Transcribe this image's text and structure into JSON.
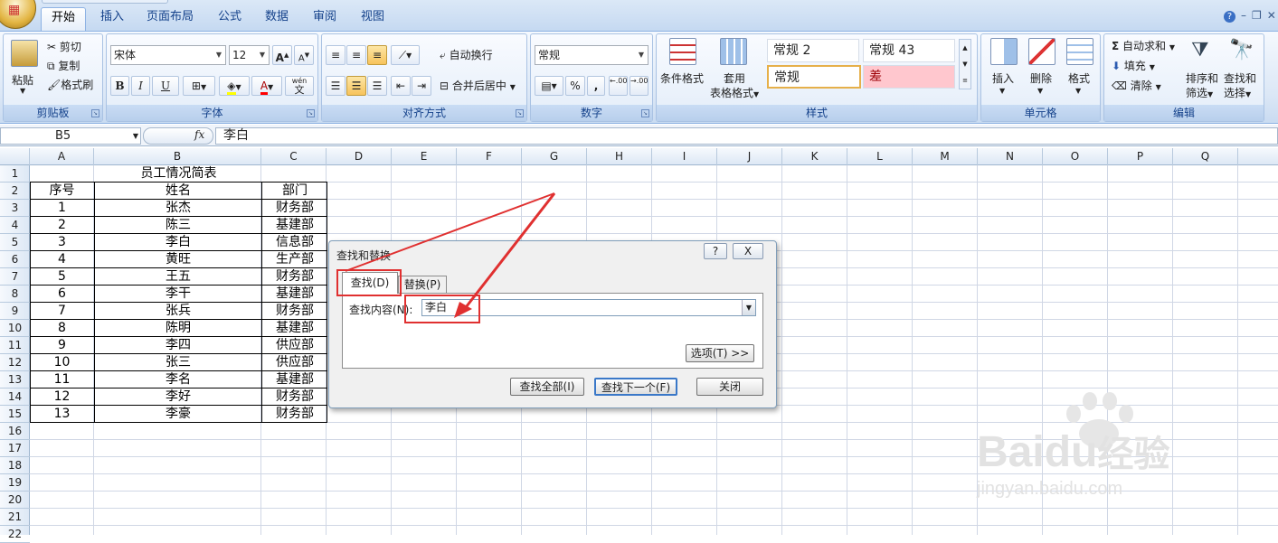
{
  "tabs": [
    {
      "label": "开始",
      "active": true
    },
    {
      "label": "插入"
    },
    {
      "label": "页面布局"
    },
    {
      "label": "公式"
    },
    {
      "label": "数据"
    },
    {
      "label": "审阅"
    },
    {
      "label": "视图"
    }
  ],
  "ribbon": {
    "clipboard": {
      "paste": "粘贴",
      "cut": "剪切",
      "copy": "复制",
      "format_painter": "格式刷",
      "group_label": "剪贴板"
    },
    "font": {
      "name": "宋体",
      "size": "12",
      "bold": "B",
      "italic": "I",
      "underline": "U",
      "grow": "A",
      "shrink": "A",
      "font_color": "A",
      "wen": "wén",
      "wen_char": "文",
      "group_label": "字体"
    },
    "alignment": {
      "wrap": "自动换行",
      "merge": "合并后居中",
      "group_label": "对齐方式"
    },
    "number": {
      "format": "常规",
      "percent": "%",
      "comma": ",",
      "inc_decimal": ".00",
      "dec_decimal": ".00",
      "group_label": "数字"
    },
    "styles": {
      "cond_format": "条件格式",
      "table_format_1": "套用",
      "table_format_2": "表格格式",
      "cell1": "常规 2",
      "cell2": "常规 43",
      "cell3": "常规",
      "cell4": "差",
      "group_label": "样式"
    },
    "cells": {
      "insert": "插入",
      "delete": "删除",
      "format": "格式",
      "group_label": "单元格"
    },
    "editing": {
      "autosum": "自动求和",
      "fill": "填充",
      "clear": "清除",
      "sort_1": "排序和",
      "sort_2": "筛选",
      "find_1": "查找和",
      "find_2": "选择",
      "group_label": "编辑"
    }
  },
  "formula_bar": {
    "name_box": "B5",
    "fx": "fx",
    "content": "李白"
  },
  "columns": [
    "A",
    "B",
    "C",
    "D",
    "E",
    "F",
    "G",
    "H",
    "I",
    "J",
    "K",
    "L",
    "M",
    "N",
    "O",
    "P",
    "Q"
  ],
  "rows": [
    "1",
    "2",
    "3",
    "4",
    "5",
    "6",
    "7",
    "8",
    "9",
    "10",
    "11",
    "12",
    "13",
    "14",
    "15",
    "16",
    "17",
    "18",
    "19",
    "20",
    "21",
    "22"
  ],
  "table": {
    "title": "员工情况简表",
    "headers": [
      "序号",
      "姓名",
      "部门"
    ],
    "data": [
      [
        "1",
        "张杰",
        "财务部"
      ],
      [
        "2",
        "陈三",
        "基建部"
      ],
      [
        "3",
        "李白",
        "信息部"
      ],
      [
        "4",
        "黄旺",
        "生产部"
      ],
      [
        "5",
        "王五",
        "财务部"
      ],
      [
        "6",
        "李干",
        "基建部"
      ],
      [
        "7",
        "张兵",
        "财务部"
      ],
      [
        "8",
        "陈明",
        "基建部"
      ],
      [
        "9",
        "李四",
        "供应部"
      ],
      [
        "10",
        "张三",
        "供应部"
      ],
      [
        "11",
        "李名",
        "基建部"
      ],
      [
        "12",
        "李好",
        "财务部"
      ],
      [
        "13",
        "李豪",
        "财务部"
      ]
    ]
  },
  "dialog": {
    "title": "查找和替换",
    "help": "?",
    "close_x": "X",
    "tab_find": "查找(D)",
    "tab_replace": "替换(P)",
    "find_label": "查找内容(N):",
    "find_value": "李白",
    "options": "选项(T) >>",
    "find_all": "查找全部(I)",
    "find_next": "查找下一个(F)",
    "close": "关闭"
  },
  "watermark": {
    "brand": "Bai",
    "brand2": "du",
    "cn": "经验",
    "url": "jingyan.baidu.com"
  },
  "accent_colors": {
    "annotation": "#e03030",
    "ribbon": "#c5d9f1"
  }
}
